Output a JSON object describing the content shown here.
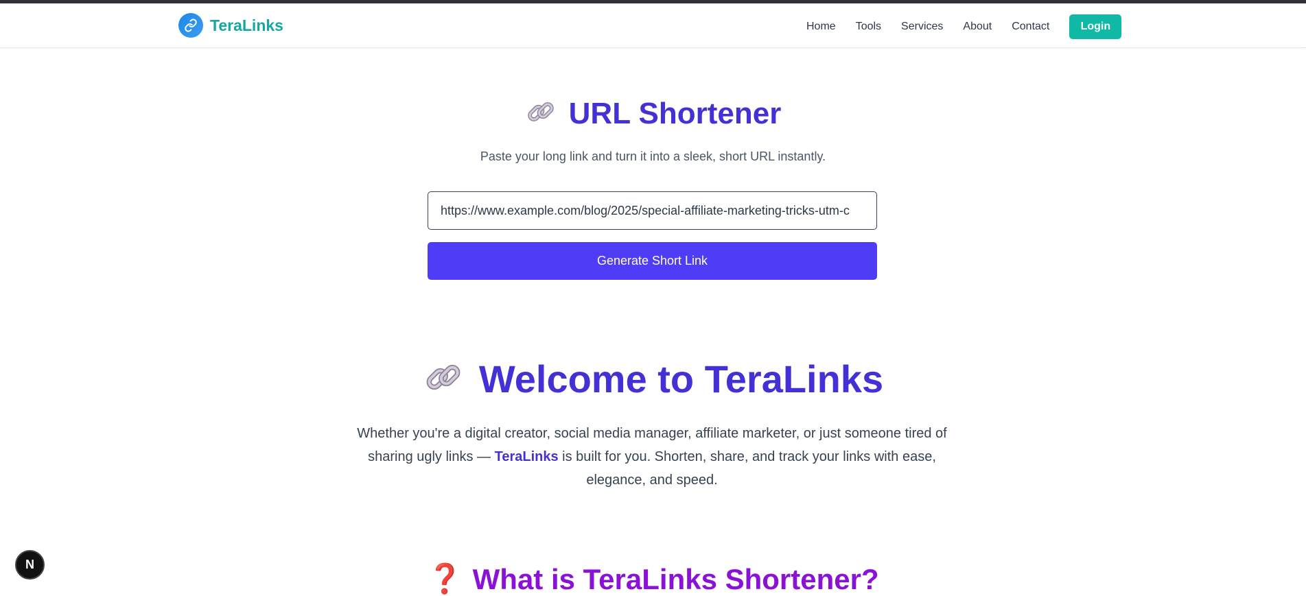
{
  "brand": {
    "name": "TeraLinks",
    "icon": "link-icon"
  },
  "nav": {
    "items": [
      "Home",
      "Tools",
      "Services",
      "About",
      "Contact"
    ],
    "login_label": "Login"
  },
  "shortener": {
    "title": "URL Shortener",
    "subtitle": "Paste your long link and turn it into a sleek, short URL instantly.",
    "input_value": "https://www.example.com/blog/2025/special-affiliate-marketing-tricks-utm-c",
    "button_label": "Generate Short Link"
  },
  "welcome": {
    "title": "Welcome to TeraLinks",
    "text_before": "Whether you're a digital creator, social media manager, affiliate marketer, or just someone tired of sharing ugly links — ",
    "text_highlight": "TeraLinks",
    "text_after": " is built for you. Shorten, share, and track your links with ease, elegance, and speed."
  },
  "what_is": {
    "title": "What is TeraLinks Shortener?"
  },
  "dev_badge": {
    "label": "N"
  },
  "colors": {
    "brand": "#14a8a0",
    "primary": "#4f3cf6",
    "heading": "#4331d6",
    "login": "#10b8a6",
    "purple_heading": "#8a12d6"
  }
}
